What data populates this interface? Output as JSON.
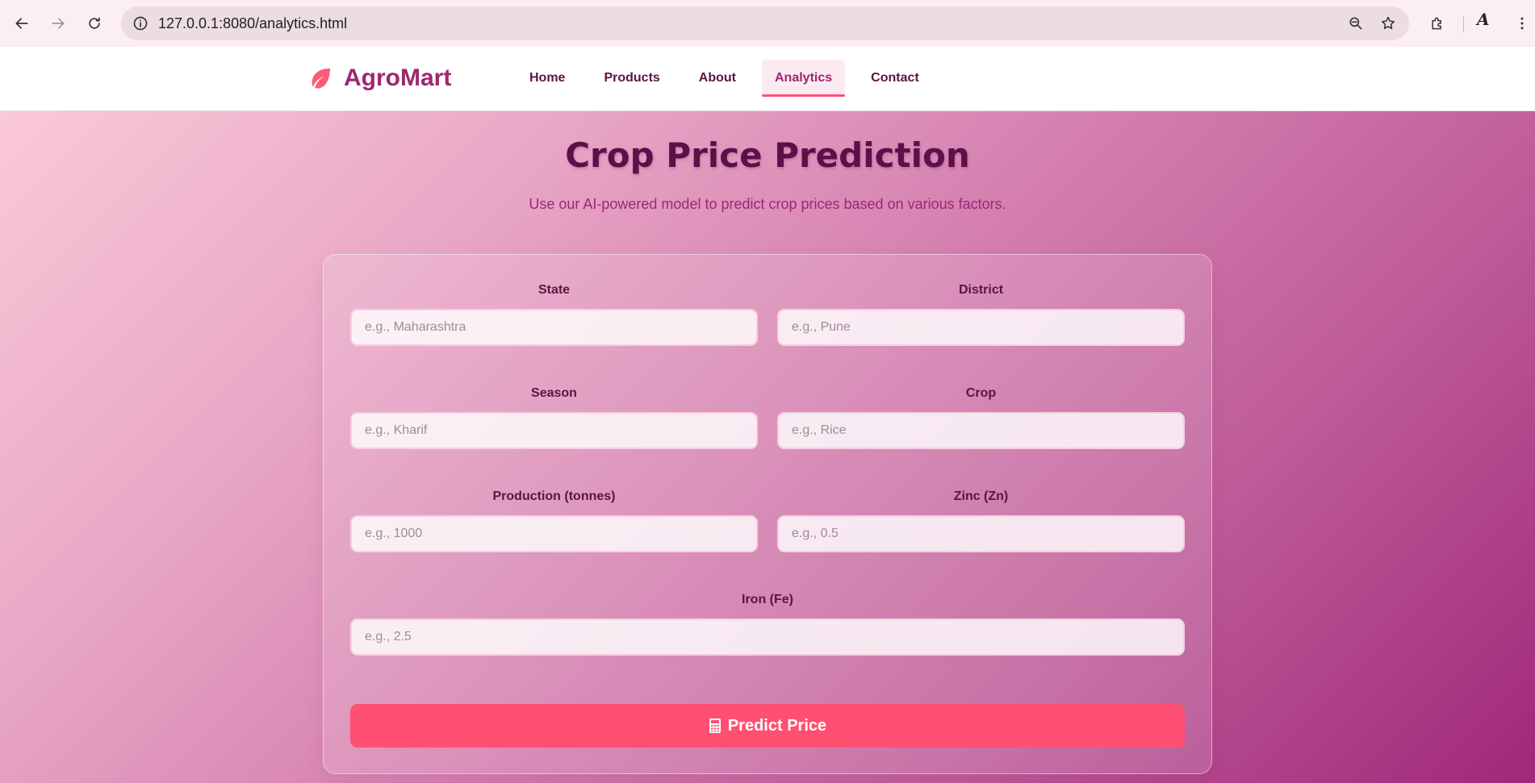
{
  "browser": {
    "url": "127.0.0.1:8080/analytics.html",
    "profile_glyph": "A"
  },
  "site": {
    "brand": "AgroMart",
    "nav": [
      {
        "label": "Home"
      },
      {
        "label": "Products"
      },
      {
        "label": "About"
      },
      {
        "label": "Analytics",
        "active": true
      },
      {
        "label": "Contact"
      }
    ]
  },
  "page": {
    "title": "Crop Price Prediction",
    "subtitle": "Use our AI-powered model to predict crop prices based on various factors."
  },
  "form": {
    "state": {
      "label": "State",
      "placeholder": "e.g., Maharashtra",
      "value": ""
    },
    "district": {
      "label": "District",
      "placeholder": "e.g., Pune",
      "value": ""
    },
    "season": {
      "label": "Season",
      "placeholder": "e.g., Kharif",
      "value": ""
    },
    "crop": {
      "label": "Crop",
      "placeholder": "e.g., Rice",
      "value": ""
    },
    "production": {
      "label": "Production (tonnes)",
      "placeholder": "e.g., 1000",
      "value": ""
    },
    "zinc": {
      "label": "Zinc (Zn)",
      "placeholder": "e.g., 0.5",
      "value": ""
    },
    "iron": {
      "label": "Iron (Fe)",
      "placeholder": "e.g., 2.5",
      "value": ""
    },
    "submit_label": "Predict Price",
    "submit_icon": "calculator-icon"
  },
  "colors": {
    "brand": "#9c2770",
    "accent": "#ff4f72",
    "heading": "#5b1049"
  }
}
